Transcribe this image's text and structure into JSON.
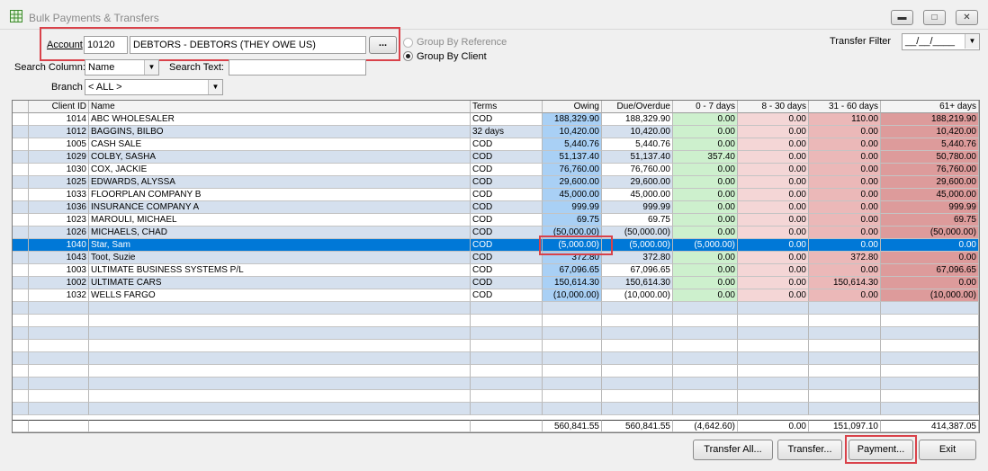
{
  "window": {
    "title": "Bulk Payments & Transfers"
  },
  "account": {
    "label": "Account",
    "code": "10120",
    "name": "DEBTORS - DEBTORS (THEY OWE US)",
    "browse_label": "..."
  },
  "grouping": {
    "by_reference_label": "Group By Reference",
    "by_client_label": "Group By Client",
    "selected": "by_client"
  },
  "transfer_filter": {
    "label": "Transfer Filter",
    "value": "__/__/____"
  },
  "search": {
    "column_label": "Search Column:",
    "column_value": "Name",
    "text_label": "Search Text:",
    "text_value": ""
  },
  "branch": {
    "label": "Branch",
    "value": "< ALL >"
  },
  "table": {
    "columns": [
      "Client ID",
      "Name",
      "Terms",
      "Owing",
      "Due/Overdue",
      "0 - 7 days",
      "8 - 30 days",
      "31 - 60 days",
      "61+ days"
    ],
    "rows": [
      {
        "id": "1014",
        "name": "ABC WHOLESALER",
        "terms": "COD",
        "owing": "188,329.90",
        "due": "188,329.90",
        "d0": "0.00",
        "d8": "0.00",
        "d31": "110.00",
        "d61": "188,219.90"
      },
      {
        "id": "1012",
        "name": "BAGGINS, BILBO",
        "terms": "32 days",
        "owing": "10,420.00",
        "due": "10,420.00",
        "d0": "0.00",
        "d8": "0.00",
        "d31": "0.00",
        "d61": "10,420.00"
      },
      {
        "id": "1005",
        "name": "CASH SALE",
        "terms": "COD",
        "owing": "5,440.76",
        "due": "5,440.76",
        "d0": "0.00",
        "d8": "0.00",
        "d31": "0.00",
        "d61": "5,440.76"
      },
      {
        "id": "1029",
        "name": "COLBY, SASHA",
        "terms": "COD",
        "owing": "51,137.40",
        "due": "51,137.40",
        "d0": "357.40",
        "d8": "0.00",
        "d31": "0.00",
        "d61": "50,780.00"
      },
      {
        "id": "1030",
        "name": "COX, JACKIE",
        "terms": "COD",
        "owing": "76,760.00",
        "due": "76,760.00",
        "d0": "0.00",
        "d8": "0.00",
        "d31": "0.00",
        "d61": "76,760.00"
      },
      {
        "id": "1025",
        "name": "EDWARDS, ALYSSA",
        "terms": "COD",
        "owing": "29,600.00",
        "due": "29,600.00",
        "d0": "0.00",
        "d8": "0.00",
        "d31": "0.00",
        "d61": "29,600.00"
      },
      {
        "id": "1033",
        "name": "FLOORPLAN COMPANY B",
        "terms": "COD",
        "owing": "45,000.00",
        "due": "45,000.00",
        "d0": "0.00",
        "d8": "0.00",
        "d31": "0.00",
        "d61": "45,000.00"
      },
      {
        "id": "1036",
        "name": "INSURANCE COMPANY A",
        "terms": "COD",
        "owing": "999.99",
        "due": "999.99",
        "d0": "0.00",
        "d8": "0.00",
        "d31": "0.00",
        "d61": "999.99"
      },
      {
        "id": "1023",
        "name": "MAROULI, MICHAEL",
        "terms": "COD",
        "owing": "69.75",
        "due": "69.75",
        "d0": "0.00",
        "d8": "0.00",
        "d31": "0.00",
        "d61": "69.75"
      },
      {
        "id": "1026",
        "name": "MICHAELS, CHAD",
        "terms": "COD",
        "owing": "(50,000.00)",
        "due": "(50,000.00)",
        "d0": "0.00",
        "d8": "0.00",
        "d31": "0.00",
        "d61": "(50,000.00)"
      },
      {
        "id": "1040",
        "name": "Star, Sam",
        "terms": "COD",
        "owing": "(5,000.00)",
        "due": "(5,000.00)",
        "d0": "(5,000.00)",
        "d8": "0.00",
        "d31": "0.00",
        "d61": "0.00"
      },
      {
        "id": "1043",
        "name": "Toot, Suzie",
        "terms": "COD",
        "owing": "372.80",
        "due": "372.80",
        "d0": "0.00",
        "d8": "0.00",
        "d31": "372.80",
        "d61": "0.00"
      },
      {
        "id": "1003",
        "name": "ULTIMATE BUSINESS SYSTEMS P/L",
        "terms": "COD",
        "owing": "67,096.65",
        "due": "67,096.65",
        "d0": "0.00",
        "d8": "0.00",
        "d31": "0.00",
        "d61": "67,096.65"
      },
      {
        "id": "1002",
        "name": "ULTIMATE CARS",
        "terms": "COD",
        "owing": "150,614.30",
        "due": "150,614.30",
        "d0": "0.00",
        "d8": "0.00",
        "d31": "150,614.30",
        "d61": "0.00"
      },
      {
        "id": "1032",
        "name": "WELLS FARGO",
        "terms": "COD",
        "owing": "(10,000.00)",
        "due": "(10,000.00)",
        "d0": "0.00",
        "d8": "0.00",
        "d31": "0.00",
        "d61": "(10,000.00)"
      }
    ],
    "selected_index": 10,
    "totals": {
      "owing": "560,841.55",
      "due": "560,841.55",
      "d0": "(4,642.60)",
      "d8": "0.00",
      "d31": "151,097.10",
      "d61": "414,387.05"
    }
  },
  "buttons": {
    "transfer_all": "Transfer All...",
    "transfer": "Transfer...",
    "payment": "Payment...",
    "exit": "Exit"
  },
  "colors": {
    "owing": "#a9d0f5",
    "d0": "#cdf0cd",
    "d8": "#f4d6d6",
    "d31": "#ebb8b8",
    "d61": "#dd9b9b",
    "stripe": "#d5e0ee",
    "selected": "#0078d7",
    "highlight": "#d9424a"
  }
}
